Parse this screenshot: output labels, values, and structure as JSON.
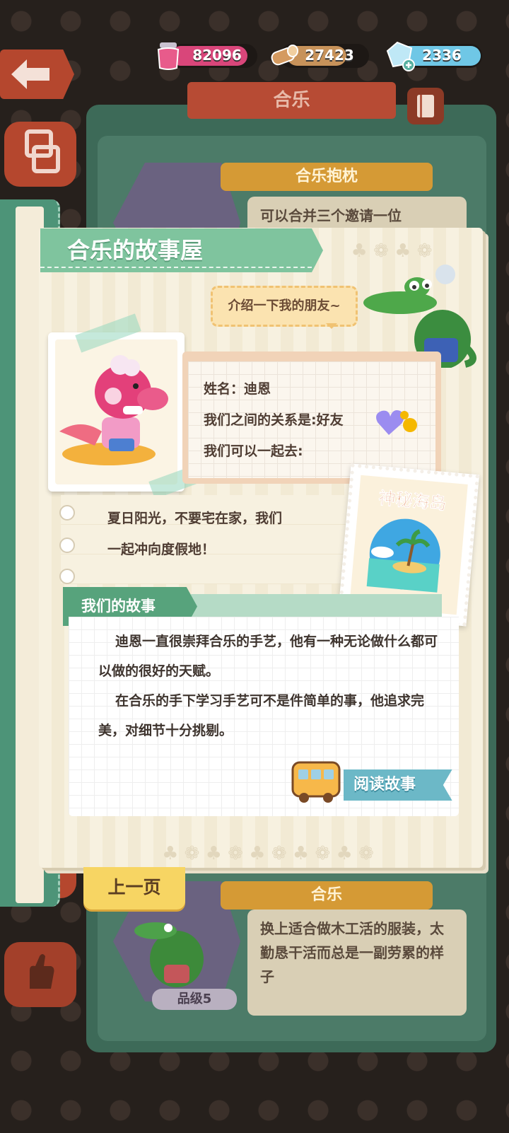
{
  "currencies": [
    {
      "icon": "potion-jar-icon",
      "value": "82096",
      "color": "#d9467a"
    },
    {
      "icon": "wood-log-icon",
      "value": "27423",
      "color": "#c7925a"
    },
    {
      "icon": "crystal-gem-icon",
      "value": "2336",
      "color": "#6fc7e6"
    }
  ],
  "background": {
    "title": "合乐",
    "card_top": {
      "label": "合乐抱枕",
      "desc": "可以合并三个邀请一位"
    },
    "card_bottom": {
      "label": "合乐",
      "desc": "换上适合做木工活的服装，太勤恳干活而总是一副劳累的样子",
      "grade": "品级5"
    }
  },
  "book": {
    "title": "合乐的故事屋",
    "bubble": "介绍一下我的朋友~",
    "info": {
      "name_line": "姓名：迪恩",
      "relation_line": "我们之间的关系是:好友",
      "together_line": "我们可以一起去:"
    },
    "note": {
      "line1": "夏日阳光，不要宅在家，我们",
      "line2": "一起冲向度假地！"
    },
    "destination": "神秘海岛",
    "story": {
      "tab": "我们的故事",
      "p1": "迪恩一直很崇拜合乐的手艺，他有一种无论做什么都可以做的很好的天赋。",
      "p2": "在合乐的手下学习手艺可不是件简单的事，他追求完美，对细节十分挑剔。"
    },
    "read_button": "阅读故事",
    "prev_page": "上一页"
  }
}
